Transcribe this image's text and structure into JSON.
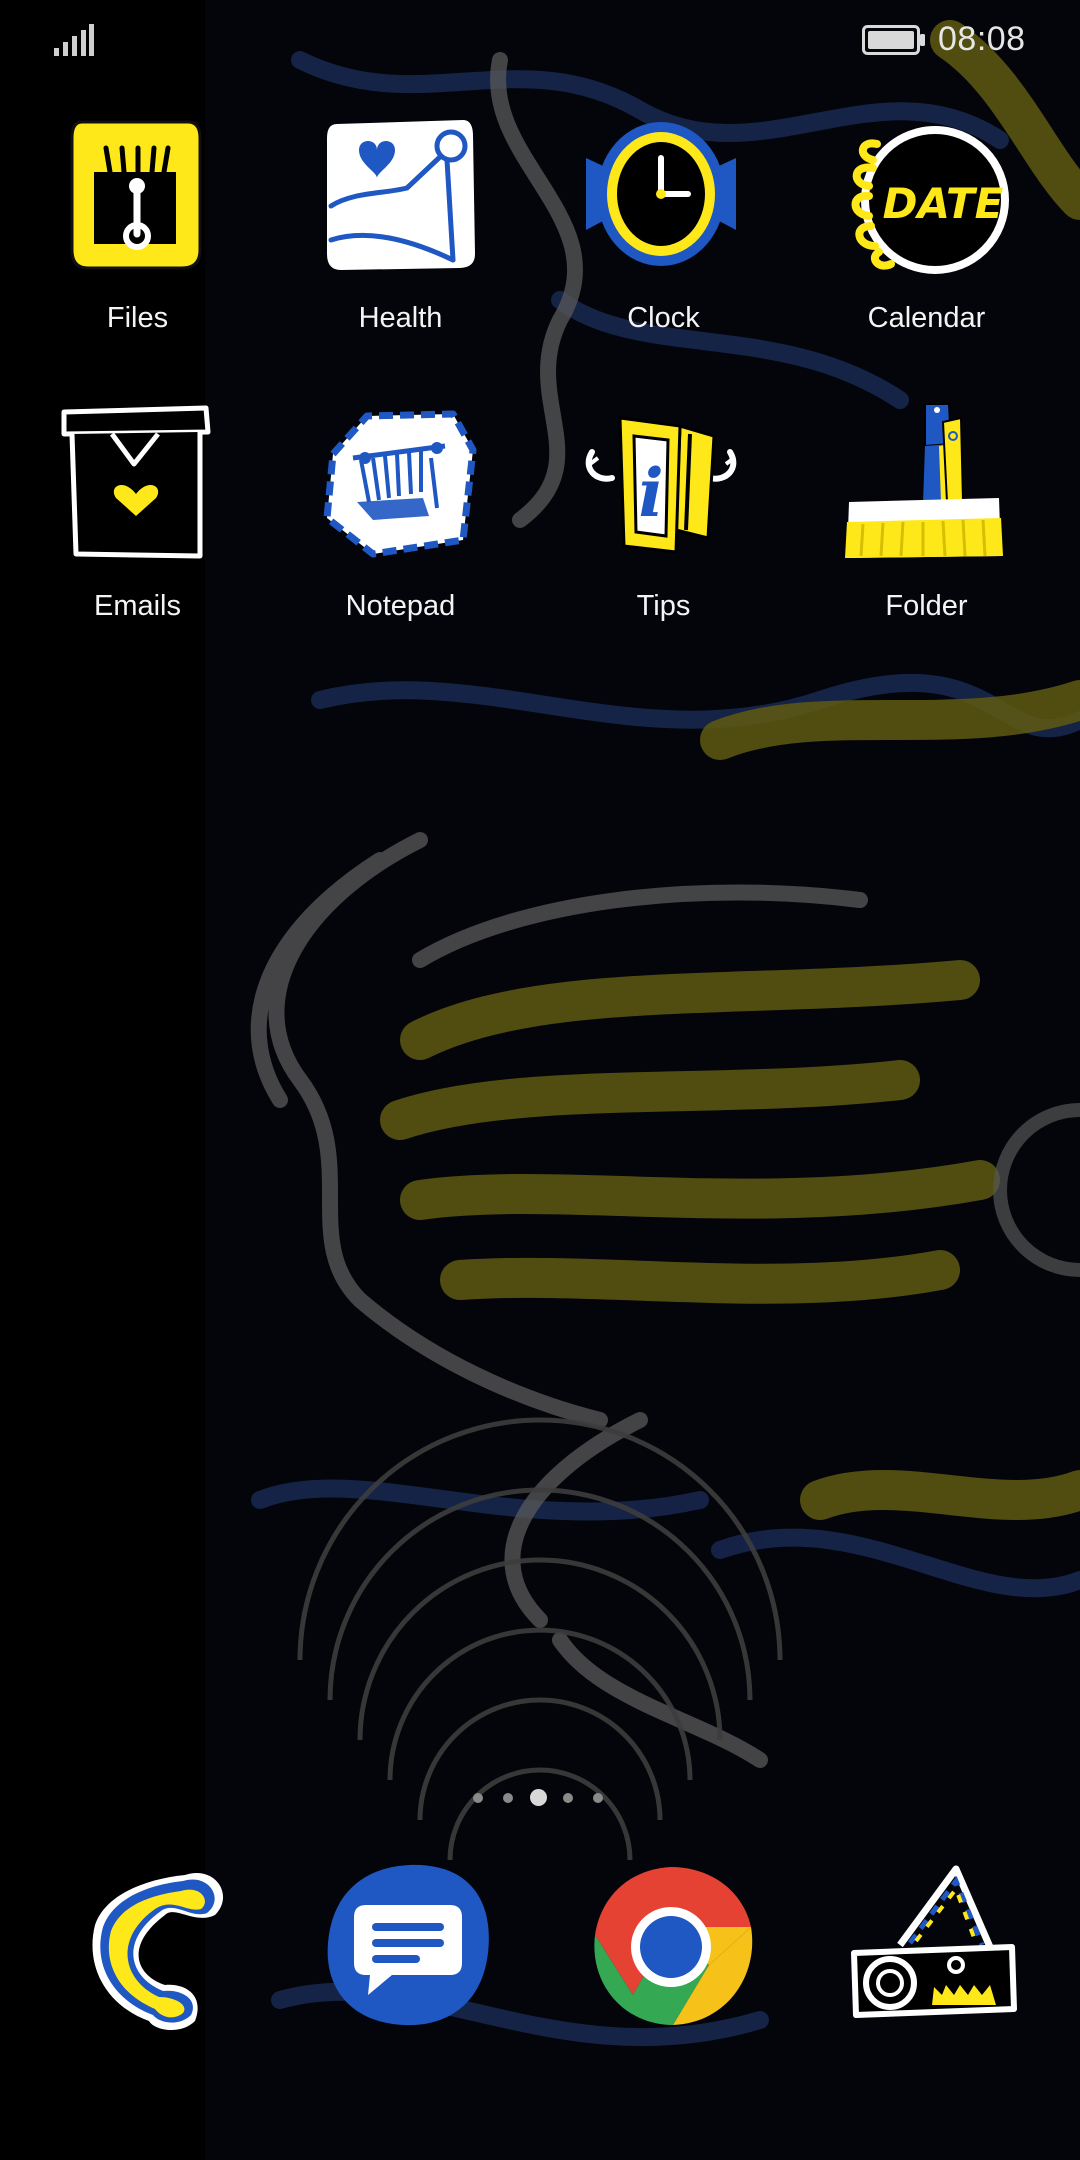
{
  "status_bar": {
    "time": "08:08",
    "signal_icon": "cellular-signal-icon",
    "battery_icon": "battery-icon"
  },
  "apps": [
    {
      "label": "Files",
      "icon": "files-icon"
    },
    {
      "label": "Health",
      "icon": "health-icon"
    },
    {
      "label": "Clock",
      "icon": "clock-icon"
    },
    {
      "label": "Calendar",
      "icon": "calendar-icon",
      "icon_text": "DATE"
    },
    {
      "label": "Emails",
      "icon": "emails-icon"
    },
    {
      "label": "Notepad",
      "icon": "notepad-icon"
    },
    {
      "label": "Tips",
      "icon": "tips-icon",
      "icon_text": "i"
    },
    {
      "label": "Folder",
      "icon": "folder-icon"
    }
  ],
  "page_indicator": {
    "pages": 5,
    "current_page": 3
  },
  "dock": [
    {
      "icon": "phone-icon"
    },
    {
      "icon": "messages-icon"
    },
    {
      "icon": "chrome-icon"
    },
    {
      "icon": "projector-icon"
    }
  ],
  "colors": {
    "background": "#000000",
    "accent_yellow": "#ffe81a",
    "accent_blue": "#1f57c3",
    "white": "#ffffff",
    "wallpaper_gray": "#5a5a5a",
    "wallpaper_olive": "#5f5a12",
    "wallpaper_navy": "#1a2a55"
  }
}
